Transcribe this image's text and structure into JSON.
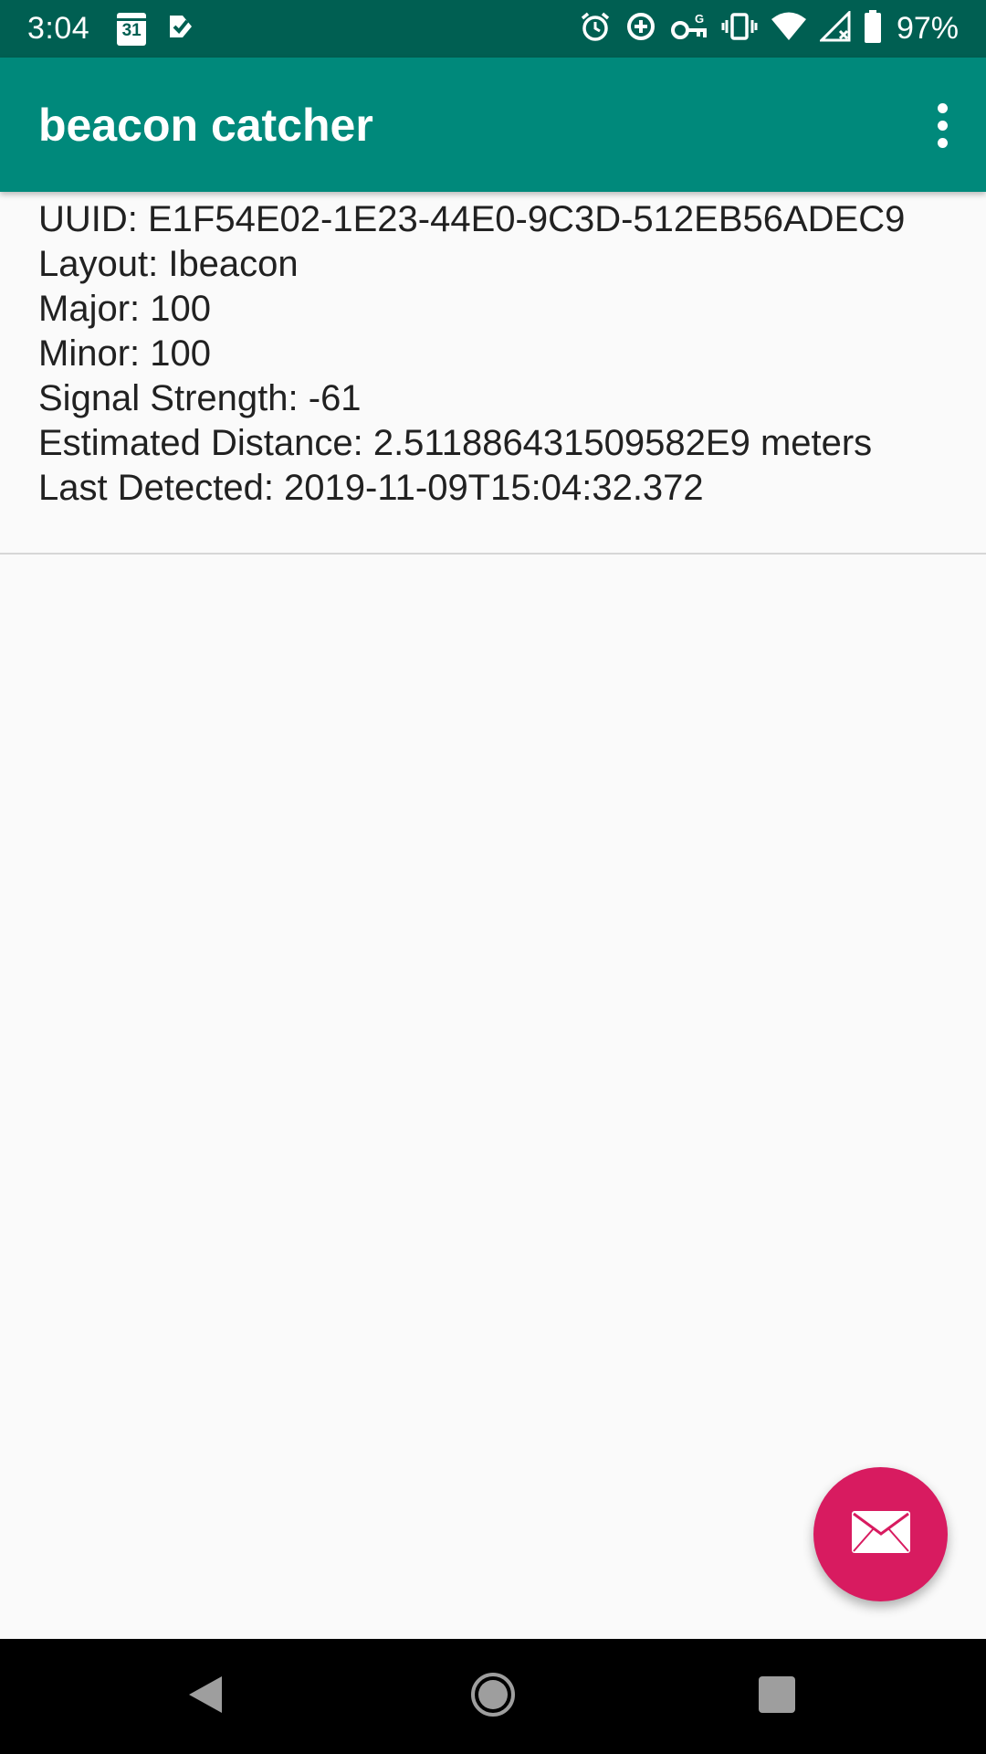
{
  "status_bar": {
    "time": "3:04",
    "calendar_day": "31",
    "battery_percent": "97%",
    "icons": [
      "calendar-icon",
      "tasks-icon",
      "alarm-icon",
      "data-saver-icon",
      "vpn-key-icon",
      "vibrate-icon",
      "wifi-icon",
      "signal-icon",
      "battery-icon"
    ]
  },
  "app_bar": {
    "title": "beacon catcher",
    "menu_icon": "more-vert-icon"
  },
  "beacons": [
    {
      "uuid": "UUID: E1F54E02-1E23-44E0-9C3D-512EB56ADEC9",
      "layout": "Layout: Ibeacon",
      "major": "Major: 100",
      "minor": "Minor: 100",
      "signal": "Signal Strength: -61",
      "distance": "Estimated Distance: 2.511886431509582E9 meters",
      "last_detected": "Last Detected: 2019-11-09T15:04:32.372"
    }
  ],
  "fab": {
    "icon": "email-icon",
    "color": "#d81b60"
  },
  "nav_bar": {
    "icons": [
      "back-icon",
      "home-icon",
      "recents-icon"
    ]
  },
  "colors": {
    "status_bar": "#005f52",
    "app_bar": "#00897b",
    "background": "#fafafa"
  }
}
